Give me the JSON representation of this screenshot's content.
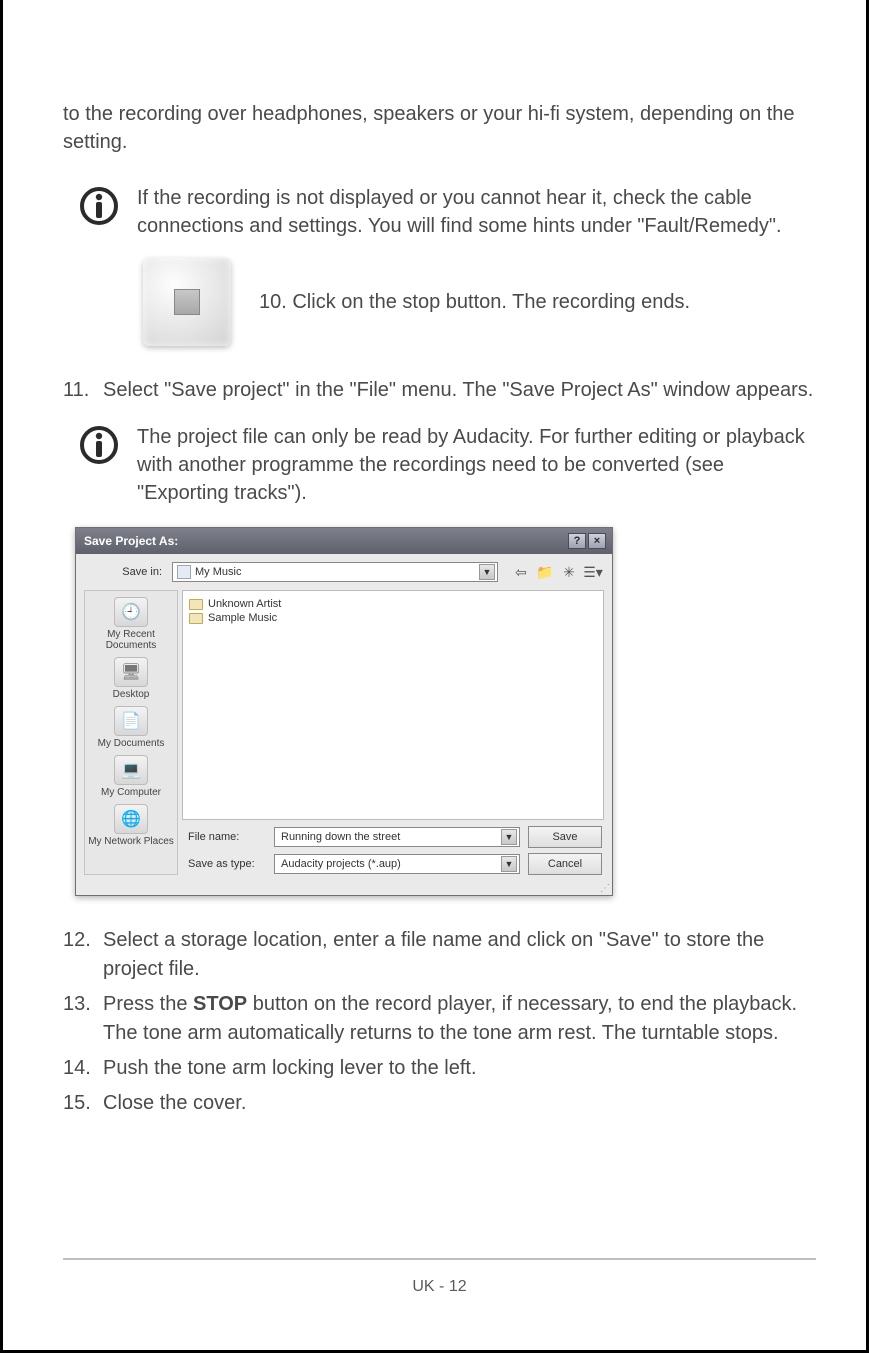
{
  "intro": "to the recording over headphones, speakers or your hi-fi system, depending on the setting.",
  "info1": "If the recording is not displayed or you cannot hear it, check the cable connections and settings. You will find some hints under \"Fault/Remedy\".",
  "step10": "10. Click on the stop button. The recording ends.",
  "step11_num": "11.",
  "step11_txt": "Select \"Save project\" in the \"File\" menu. The \"Save Project As\" window appears.",
  "info2": "The project file can only be read by Audacity. For further editing or playback with another programme the recordings need to be converted (see \"Exporting tracks\").",
  "dialog": {
    "title": "Save Project As:",
    "savein_label": "Save in:",
    "savein_value": "My Music",
    "places": {
      "recent": "My Recent Documents",
      "desktop": "Desktop",
      "mydocs": "My Documents",
      "mycomp": "My Computer",
      "mynet": "My Network Places"
    },
    "files": {
      "item1": "Unknown Artist",
      "item2": "Sample Music"
    },
    "filename_label": "File name:",
    "filename_value": "Running down the street",
    "saveas_label": "Save as type:",
    "saveas_value": "Audacity projects (*.aup)",
    "save_btn": "Save",
    "cancel_btn": "Cancel"
  },
  "step12_num": "12.",
  "step12_txt": "Select a storage location, enter a file name and click on \"Save\" to store the project file.",
  "step13_num": "13.",
  "step13_txt_before": "Press the ",
  "step13_bold": "STOP",
  "step13_txt_after": " button on the record player, if necessary, to end the playback. The tone arm automatically returns to the tone arm rest. The turntable stops.",
  "step14_num": "14.",
  "step14_txt": "Push the tone arm locking lever to the left.",
  "step15_num": "15.",
  "step15_txt": "Close the cover.",
  "footer": "UK - 12"
}
